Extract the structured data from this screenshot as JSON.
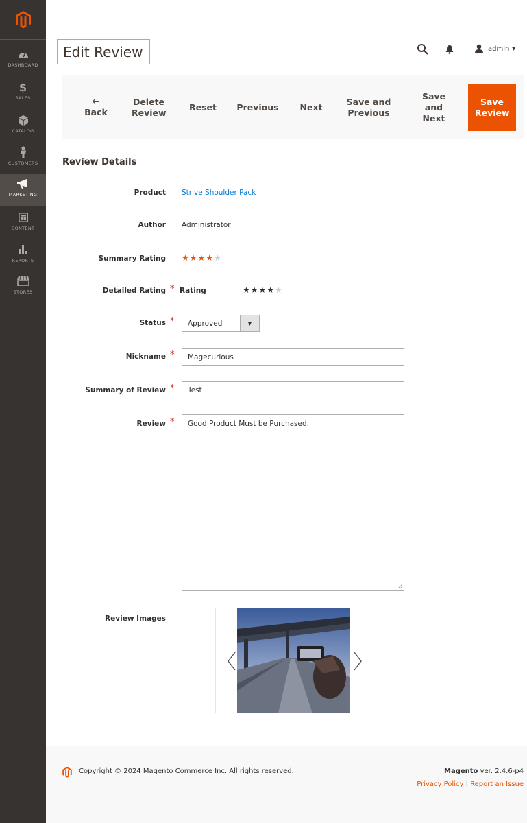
{
  "sidebar": {
    "items": [
      {
        "label": "DASHBOARD",
        "icon": "dashboard-icon"
      },
      {
        "label": "SALES",
        "icon": "dollar-icon"
      },
      {
        "label": "CATALOG",
        "icon": "cube-icon"
      },
      {
        "label": "CUSTOMERS",
        "icon": "person-icon"
      },
      {
        "label": "MARKETING",
        "icon": "megaphone-icon",
        "active": true
      },
      {
        "label": "CONTENT",
        "icon": "layout-icon"
      },
      {
        "label": "REPORTS",
        "icon": "bar-chart-icon"
      },
      {
        "label": "STORES",
        "icon": "store-icon"
      }
    ]
  },
  "header": {
    "title": "Edit Review",
    "user": "admin"
  },
  "actions": {
    "back": "Back",
    "delete": "Delete Review",
    "reset": "Reset",
    "previous": "Previous",
    "next": "Next",
    "save_previous": "Save and Previous",
    "save_next": "Save and Next",
    "save": "Save Review"
  },
  "section": {
    "title": "Review Details"
  },
  "form": {
    "product_label": "Product",
    "product_value": "Strive Shoulder Pack",
    "author_label": "Author",
    "author_value": "Administrator",
    "summary_rating_label": "Summary Rating",
    "summary_rating_value": 4,
    "summary_rating_max": 5,
    "detailed_rating_label": "Detailed Rating",
    "detailed_rating_sublabel": "Rating",
    "detailed_rating_value": 4,
    "status_label": "Status",
    "status_value": "Approved",
    "nickname_label": "Nickname",
    "nickname_value": "Magecurious",
    "summary_label": "Summary of Review",
    "summary_value": "Test",
    "review_label": "Review",
    "review_value": "Good Product Must be Purchased.",
    "images_label": "Review Images"
  },
  "footer": {
    "copyright": "Copyright © 2024 Magento Commerce Inc. All rights reserved.",
    "brand": "Magento",
    "version": "ver. 2.4.6-p4",
    "privacy": "Privacy Policy",
    "separator": "|",
    "report": "Report an Issue"
  },
  "colors": {
    "accent": "#eb5202",
    "sidebar": "#373330",
    "link": "#007bdb",
    "title_border": "#f19c38"
  }
}
